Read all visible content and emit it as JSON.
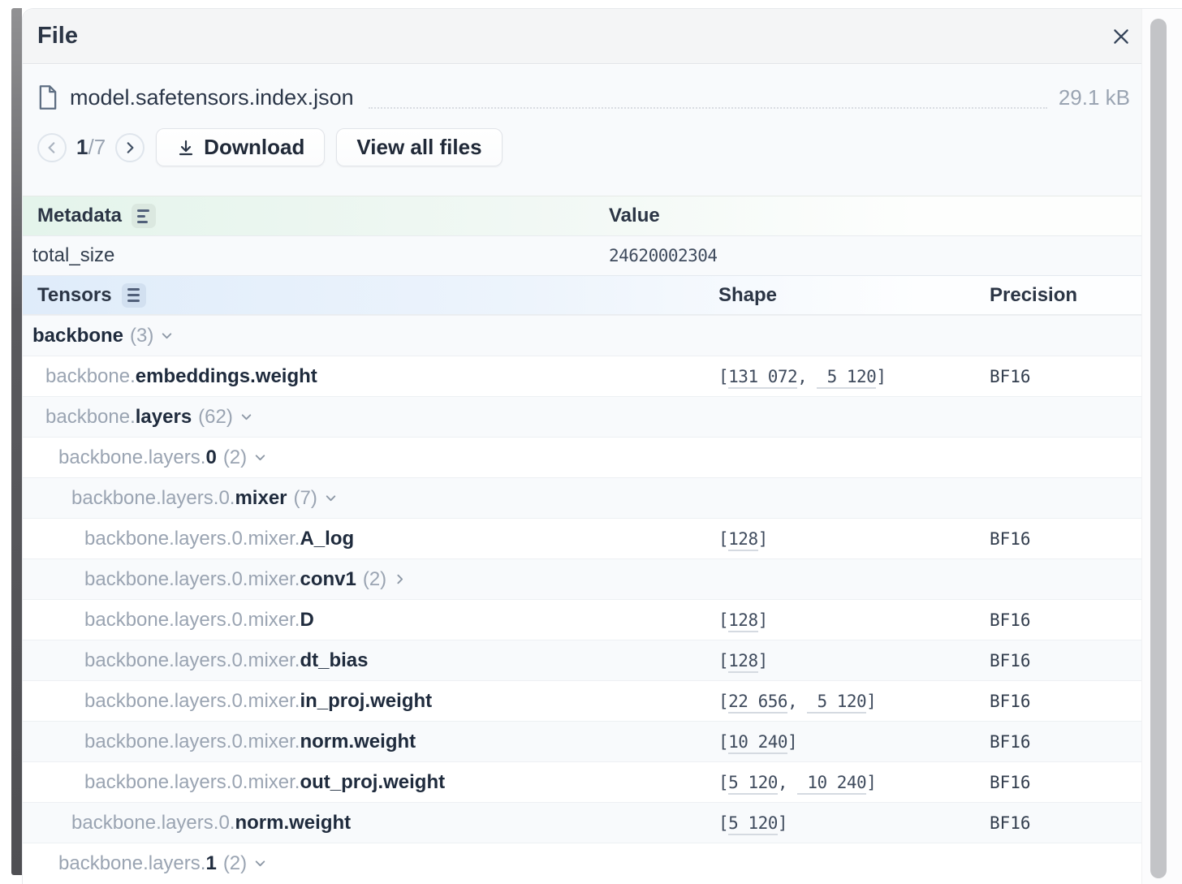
{
  "modal": {
    "title": "File"
  },
  "file": {
    "name": "model.safetensors.index.json",
    "size": "29.1 kB"
  },
  "pagination": {
    "current": "1",
    "separator": "/",
    "total": "7"
  },
  "toolbar": {
    "download_label": "Download",
    "view_all_label": "View all files"
  },
  "metadata": {
    "header": "Metadata",
    "value_header": "Value",
    "rows": [
      {
        "key": "total_size",
        "value": "24620002304"
      }
    ]
  },
  "tensors": {
    "header": "Tensors",
    "shape_header": "Shape",
    "precision_header": "Precision",
    "rows": [
      {
        "level": 0,
        "prefix": "",
        "name": "backbone",
        "count": "(3)",
        "expanded": true
      },
      {
        "level": 1,
        "prefix": "backbone.",
        "name": "embeddings.weight",
        "shape": [
          131072,
          5120
        ],
        "precision": "BF16"
      },
      {
        "level": 1,
        "prefix": "backbone.",
        "name": "layers",
        "count": "(62)",
        "expanded": true
      },
      {
        "level": 2,
        "prefix": "backbone.layers.",
        "name": "0",
        "count": "(2)",
        "expanded": true
      },
      {
        "level": 3,
        "prefix": "backbone.layers.0.",
        "name": "mixer",
        "count": "(7)",
        "expanded": true
      },
      {
        "level": 4,
        "prefix": "backbone.layers.0.mixer.",
        "name": "A_log",
        "shape": [
          128
        ],
        "precision": "BF16"
      },
      {
        "level": 4,
        "prefix": "backbone.layers.0.mixer.",
        "name": "conv1",
        "count": "(2)",
        "expanded": false
      },
      {
        "level": 4,
        "prefix": "backbone.layers.0.mixer.",
        "name": "D",
        "shape": [
          128
        ],
        "precision": "BF16"
      },
      {
        "level": 4,
        "prefix": "backbone.layers.0.mixer.",
        "name": "dt_bias",
        "shape": [
          128
        ],
        "precision": "BF16"
      },
      {
        "level": 4,
        "prefix": "backbone.layers.0.mixer.",
        "name": "in_proj.weight",
        "shape": [
          22656,
          5120
        ],
        "precision": "BF16"
      },
      {
        "level": 4,
        "prefix": "backbone.layers.0.mixer.",
        "name": "norm.weight",
        "shape": [
          10240
        ],
        "precision": "BF16"
      },
      {
        "level": 4,
        "prefix": "backbone.layers.0.mixer.",
        "name": "out_proj.weight",
        "shape": [
          5120,
          10240
        ],
        "precision": "BF16"
      },
      {
        "level": 3,
        "prefix": "backbone.layers.0.",
        "name": "norm.weight",
        "shape": [
          5120
        ],
        "precision": "BF16"
      },
      {
        "level": 2,
        "prefix": "backbone.layers.",
        "name": "1",
        "count": "(2)",
        "expanded": true
      }
    ]
  },
  "colors": {
    "accent_green_header": "#e4f4eb",
    "accent_blue_header": "#dfecfa",
    "text_dark": "#1f2b3d",
    "text_muted": "#9aa4b2"
  }
}
